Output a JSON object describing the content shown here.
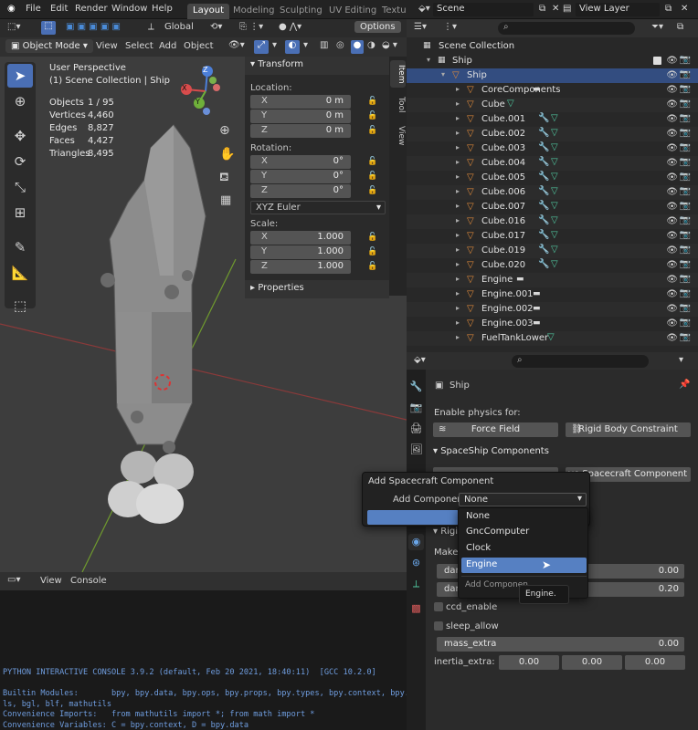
{
  "topbar": {
    "menus": [
      "File",
      "Edit",
      "Render",
      "Window",
      "Help"
    ],
    "workspaces": [
      "Layout",
      "Modeling",
      "Sculpting",
      "UV Editing",
      "Textu"
    ],
    "active_workspace": "Layout",
    "scene": "Scene",
    "view_layer": "View Layer"
  },
  "viewport": {
    "orientation": "Global",
    "options_label": "Options",
    "mode": "Object Mode",
    "menus": [
      "View",
      "Select",
      "Add",
      "Object"
    ],
    "overlay_title": "User Perspective",
    "overlay_subtitle": "(1) Scene Collection | Ship",
    "stats": [
      {
        "k": "Objects",
        "v": "1 / 95"
      },
      {
        "k": "Vertices",
        "v": "4,460"
      },
      {
        "k": "Edges",
        "v": "8,827"
      },
      {
        "k": "Faces",
        "v": "4,427"
      },
      {
        "k": "Triangles",
        "v": "8,495"
      }
    ],
    "gizmo": {
      "x": "X",
      "y": "Y",
      "z": "Z"
    }
  },
  "npanel": {
    "section_transform": "Transform",
    "location_label": "Location:",
    "location": [
      {
        "k": "X",
        "v": "0 m"
      },
      {
        "k": "Y",
        "v": "0 m"
      },
      {
        "k": "Z",
        "v": "0 m"
      }
    ],
    "rotation_label": "Rotation:",
    "rotation": [
      {
        "k": "X",
        "v": "0°"
      },
      {
        "k": "Y",
        "v": "0°"
      },
      {
        "k": "Z",
        "v": "0°"
      }
    ],
    "rotation_mode": "XYZ Euler",
    "scale_label": "Scale:",
    "scale": [
      {
        "k": "X",
        "v": "1.000"
      },
      {
        "k": "Y",
        "v": "1.000"
      },
      {
        "k": "Z",
        "v": "1.000"
      }
    ],
    "section_properties": "Properties",
    "tabs": [
      "Item",
      "Tool",
      "View"
    ]
  },
  "outliner": {
    "root": "Scene Collection",
    "rows": [
      {
        "label": "Ship",
        "indent": 0,
        "type": "collection"
      },
      {
        "label": "Ship",
        "indent": 1,
        "type": "object",
        "selected": true
      },
      {
        "label": "CoreComponents",
        "indent": 2,
        "type": "object"
      },
      {
        "label": "Cube",
        "indent": 2,
        "type": "mesh"
      },
      {
        "label": "Cube.001",
        "indent": 2,
        "type": "modmesh"
      },
      {
        "label": "Cube.002",
        "indent": 2,
        "type": "modmesh"
      },
      {
        "label": "Cube.003",
        "indent": 2,
        "type": "modmesh"
      },
      {
        "label": "Cube.004",
        "indent": 2,
        "type": "modmesh"
      },
      {
        "label": "Cube.005",
        "indent": 2,
        "type": "modmesh"
      },
      {
        "label": "Cube.006",
        "indent": 2,
        "type": "modmesh"
      },
      {
        "label": "Cube.007",
        "indent": 2,
        "type": "modmesh"
      },
      {
        "label": "Cube.016",
        "indent": 2,
        "type": "modmesh"
      },
      {
        "label": "Cube.017",
        "indent": 2,
        "type": "modmesh"
      },
      {
        "label": "Cube.019",
        "indent": 2,
        "type": "modmesh"
      },
      {
        "label": "Cube.020",
        "indent": 2,
        "type": "modmesh"
      },
      {
        "label": "Engine",
        "indent": 2,
        "type": "object"
      },
      {
        "label": "Engine.001",
        "indent": 2,
        "type": "object"
      },
      {
        "label": "Engine.002",
        "indent": 2,
        "type": "object"
      },
      {
        "label": "Engine.003",
        "indent": 2,
        "type": "object"
      },
      {
        "label": "FuelTankLower",
        "indent": 2,
        "type": "mesh"
      }
    ]
  },
  "properties": {
    "object_name": "Ship",
    "enable_physics": "Enable physics for:",
    "force_field": "Force Field",
    "rigid_body_constraint": "Rigid Body Constraint",
    "spaceship_section": "SpaceShip Components",
    "remove_component": "ve Spacecraft Component",
    "rigid_partial": "Rigi",
    "makes_partial": "Makes",
    "dam1": "dam",
    "dam1_value": "0.00",
    "dam2": "dam",
    "dam2_value": "0.20",
    "ccd_enable": "ccd_enable",
    "sleep_allow": "sleep_allow",
    "mass_extra": "mass_extra",
    "mass_extra_value": "0.00",
    "inertia_extra": "inertia_extra:",
    "inertia_values": [
      "0.00",
      "0.00",
      "0.00"
    ]
  },
  "popup": {
    "title": "Add Spacecraft Component",
    "add_label": "Add Component",
    "selected": "None",
    "options": [
      "None",
      "GncComputer",
      "Clock",
      "Engine"
    ],
    "hover": "Engine",
    "footer": "Add Componen",
    "tooltip": "Engine."
  },
  "console": {
    "menus": [
      "View",
      "Console"
    ],
    "lines": [
      "PYTHON INTERACTIVE CONSOLE 3.9.2 (default, Feb 20 2021, 18:40:11)  [GCC 10.2.0]",
      "",
      "Builtin Modules:       bpy, bpy.data, bpy.ops, bpy.props, bpy.types, bpy.context, bpy.uti",
      "ls, bgl, blf, mathutils",
      "Convenience Imports:   from mathutils import *; from math import *",
      "Convenience Variables: C = bpy.context, D = bpy.data"
    ]
  }
}
